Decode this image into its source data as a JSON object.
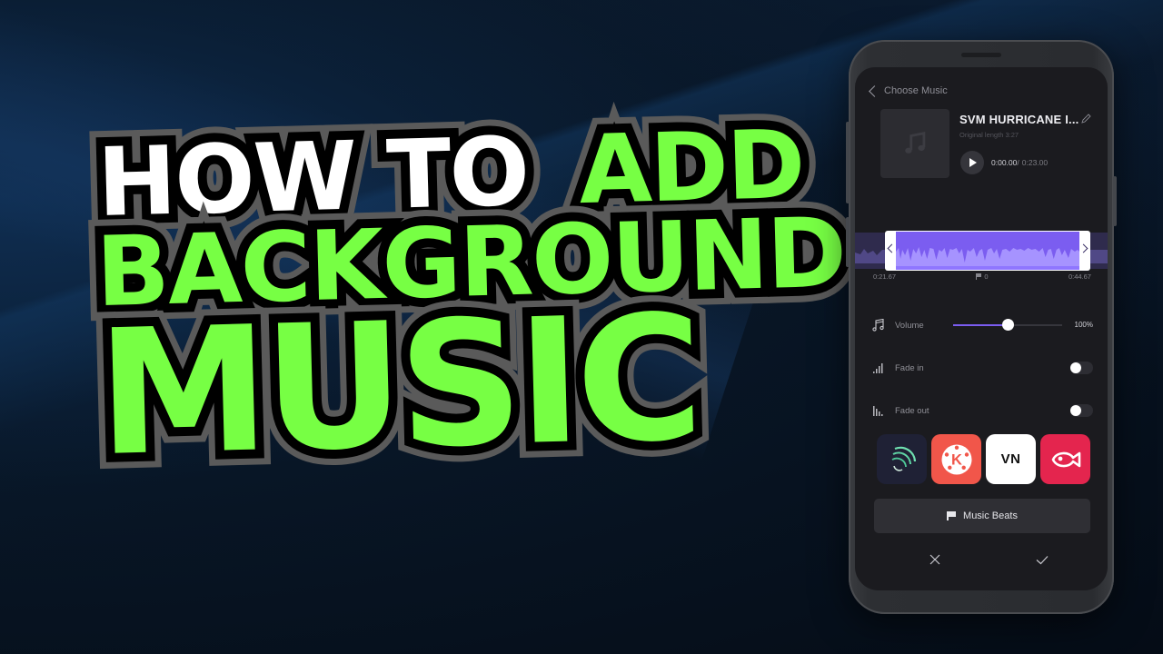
{
  "thumbnail": {
    "headline": {
      "line1_white": "HOW TO",
      "line1_green": "ADD",
      "line2": "BACKGROUND",
      "line3": "MUSIC"
    },
    "colors": {
      "accent_green": "#77ff44",
      "title_white": "#ffffff",
      "outline_black": "#000000",
      "outline_gray": "#5a5a5a",
      "background_navy": "#07111f"
    }
  },
  "phone": {
    "screen": {
      "topbar": {
        "back_icon": "chevron-left",
        "title": "Choose Music"
      },
      "track": {
        "artwork_icon": "music-note",
        "title": "SVM HURRICANE I...",
        "edit_icon": "pencil",
        "original_length": "Original length 3:27",
        "play_icon": "play",
        "current_time": "0:00.00",
        "separator": "/",
        "total_time": "0:23.00"
      },
      "waveform": {
        "start_time": "0:21.67",
        "marker_count": "0",
        "end_time": "0:44.67",
        "selection_color": "#7b5df0"
      },
      "settings": {
        "volume": {
          "label": "Volume",
          "value": "100%",
          "slider_fraction": 0.5
        },
        "fade_in": {
          "label": "Fade in",
          "enabled": false
        },
        "fade_out": {
          "label": "Fade out",
          "enabled": false
        }
      },
      "apps": [
        {
          "name": "Alight Motion",
          "icon": "alight-motion-icon"
        },
        {
          "name": "KineMaster",
          "icon": "kinemaster-icon",
          "glyph": "K"
        },
        {
          "name": "VN",
          "icon": "vn-icon",
          "glyph": "VN"
        },
        {
          "name": "VITA",
          "icon": "vita-icon"
        }
      ],
      "music_beats_button": {
        "icon": "flag",
        "label": "Music Beats"
      },
      "actions": {
        "cancel_icon": "close",
        "confirm_icon": "check"
      }
    }
  }
}
